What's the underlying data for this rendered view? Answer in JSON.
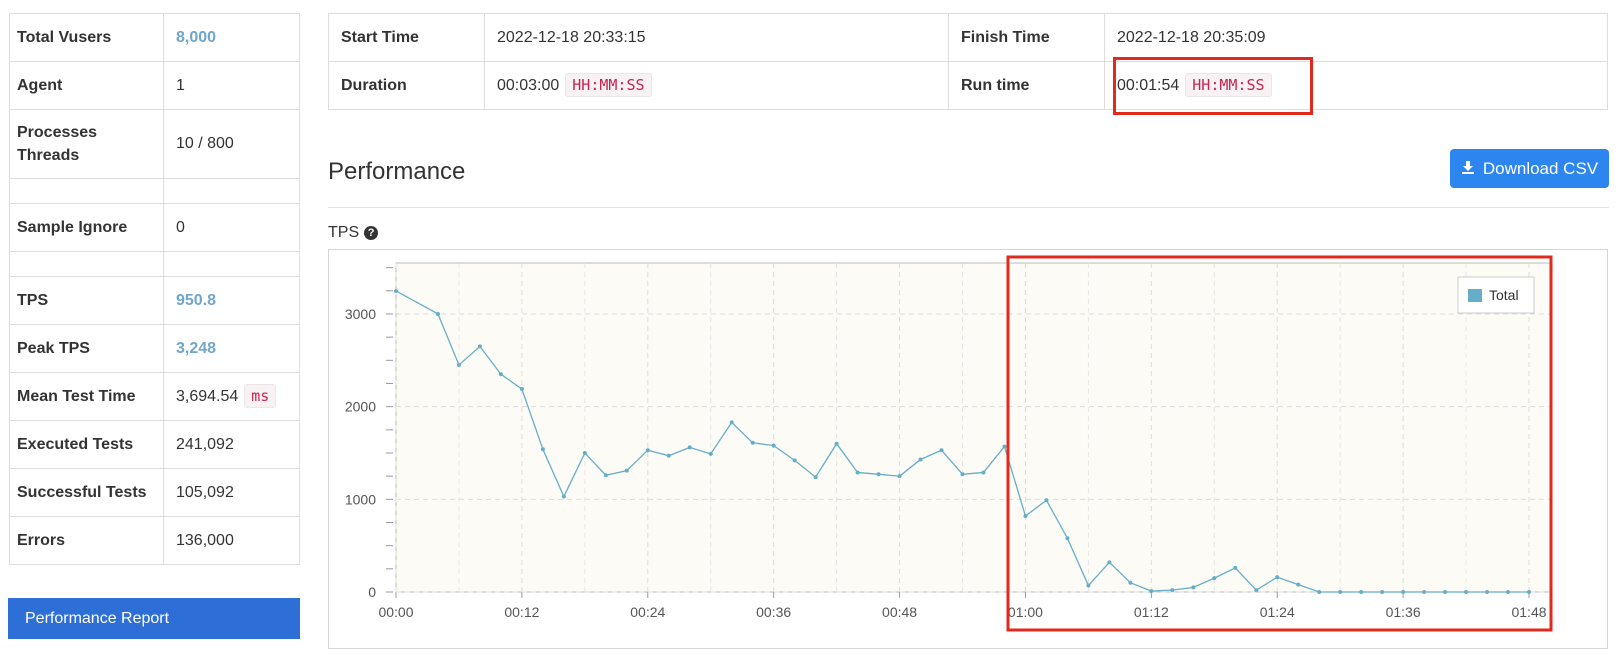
{
  "summary": {
    "total_vusers": {
      "label": "Total Vusers",
      "value": "8,000"
    },
    "agent": {
      "label": "Agent",
      "value": "1"
    },
    "processes_threads": {
      "label1": "Processes",
      "label2": "Threads",
      "value": "10 / 800"
    },
    "sample_ignore": {
      "label": "Sample Ignore",
      "value": "0"
    },
    "tps": {
      "label": "TPS",
      "value": "950.8"
    },
    "peak_tps": {
      "label": "Peak TPS",
      "value": "3,248"
    },
    "mean_test_time": {
      "label": "Mean Test Time",
      "value": "3,694.54",
      "unit": "ms"
    },
    "executed_tests": {
      "label": "Executed Tests",
      "value": "241,092"
    },
    "successful_tests": {
      "label": "Successful Tests",
      "value": "105,092"
    },
    "errors": {
      "label": "Errors",
      "value": "136,000"
    }
  },
  "report_button": "Performance Report",
  "times": {
    "start_label": "Start Time",
    "start_value": "2022-12-18 20:33:15",
    "finish_label": "Finish Time",
    "finish_value": "2022-12-18 20:35:09",
    "duration_label": "Duration",
    "duration_value": "00:03:00",
    "duration_format": "HH:MM:SS",
    "runtime_label": "Run time",
    "runtime_value": "00:01:54",
    "runtime_format": "HH:MM:SS"
  },
  "performance": {
    "title": "Performance",
    "download_label": "Download CSV",
    "tps_label": "TPS"
  },
  "colors": {
    "accent_blue": "#2d86f0",
    "report_blue": "#2d6fd6",
    "highlight_red": "#e02a1d",
    "series_line": "#66aec7",
    "value_highlight": "#6fa6c9"
  },
  "chart_data": {
    "type": "line",
    "title": "",
    "xlabel": "",
    "ylabel": "",
    "x_ticks": [
      "00:00",
      "00:12",
      "00:24",
      "00:36",
      "00:48",
      "01:00",
      "01:12",
      "01:24",
      "01:36",
      "01:48"
    ],
    "y_ticks": [
      0,
      1000,
      2000,
      3000
    ],
    "xlim_seconds": [
      0,
      110
    ],
    "ylim": [
      0,
      3550
    ],
    "grid": true,
    "legend_position": "top-right",
    "series": [
      {
        "name": "Total",
        "color": "#66aec7",
        "x": [
          0,
          4,
          6,
          8,
          10,
          12,
          14,
          16,
          18,
          20,
          22,
          24,
          26,
          28,
          30,
          32,
          34,
          36,
          38,
          40,
          42,
          44,
          46,
          48,
          50,
          52,
          54,
          56,
          58,
          60,
          62,
          64,
          66,
          68,
          70,
          72,
          74,
          76,
          78,
          80,
          82,
          84,
          86,
          88,
          90,
          92,
          94,
          96,
          98,
          100,
          102,
          104,
          106,
          108
        ],
        "y": [
          3248,
          3000,
          2450,
          2650,
          2350,
          2190,
          1540,
          1030,
          1500,
          1260,
          1310,
          1530,
          1470,
          1560,
          1490,
          1830,
          1610,
          1580,
          1420,
          1240,
          1600,
          1290,
          1270,
          1250,
          1430,
          1530,
          1270,
          1290,
          1570,
          820,
          990,
          580,
          70,
          320,
          100,
          10,
          20,
          50,
          150,
          260,
          20,
          160,
          80,
          0,
          0,
          0,
          0,
          0,
          0,
          0,
          0,
          0,
          0,
          0
        ]
      }
    ]
  }
}
